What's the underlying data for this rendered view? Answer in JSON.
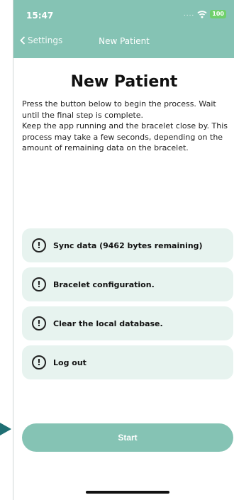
{
  "status_bar": {
    "time": "15:47",
    "signal": "....",
    "battery": "100"
  },
  "nav": {
    "back_label": "Settings",
    "title": "New Patient"
  },
  "main": {
    "title": "New Patient",
    "description": [
      "Press the button below to begin the process. Wait until the final step is complete.",
      "Keep the app running and the bracelet close by. This process may take a few seconds, depending on the amount of remaining data on the bracelet."
    ]
  },
  "steps": [
    {
      "icon": "!",
      "label": "Sync data (9462 bytes remaining)"
    },
    {
      "icon": "!",
      "label": "Bracelet configuration."
    },
    {
      "icon": "!",
      "label": "Clear the local database."
    },
    {
      "icon": "!",
      "label": "Log out"
    }
  ],
  "start_button": {
    "label": "Start"
  },
  "colors": {
    "accent": "#85c3b4",
    "step_background": "#e7f3ef",
    "annotation_arrow": "#1f6f73"
  },
  "icons": {
    "back": "chevron-left-icon",
    "wifi": "wifi-icon",
    "step": "exclamation-circle-icon"
  }
}
